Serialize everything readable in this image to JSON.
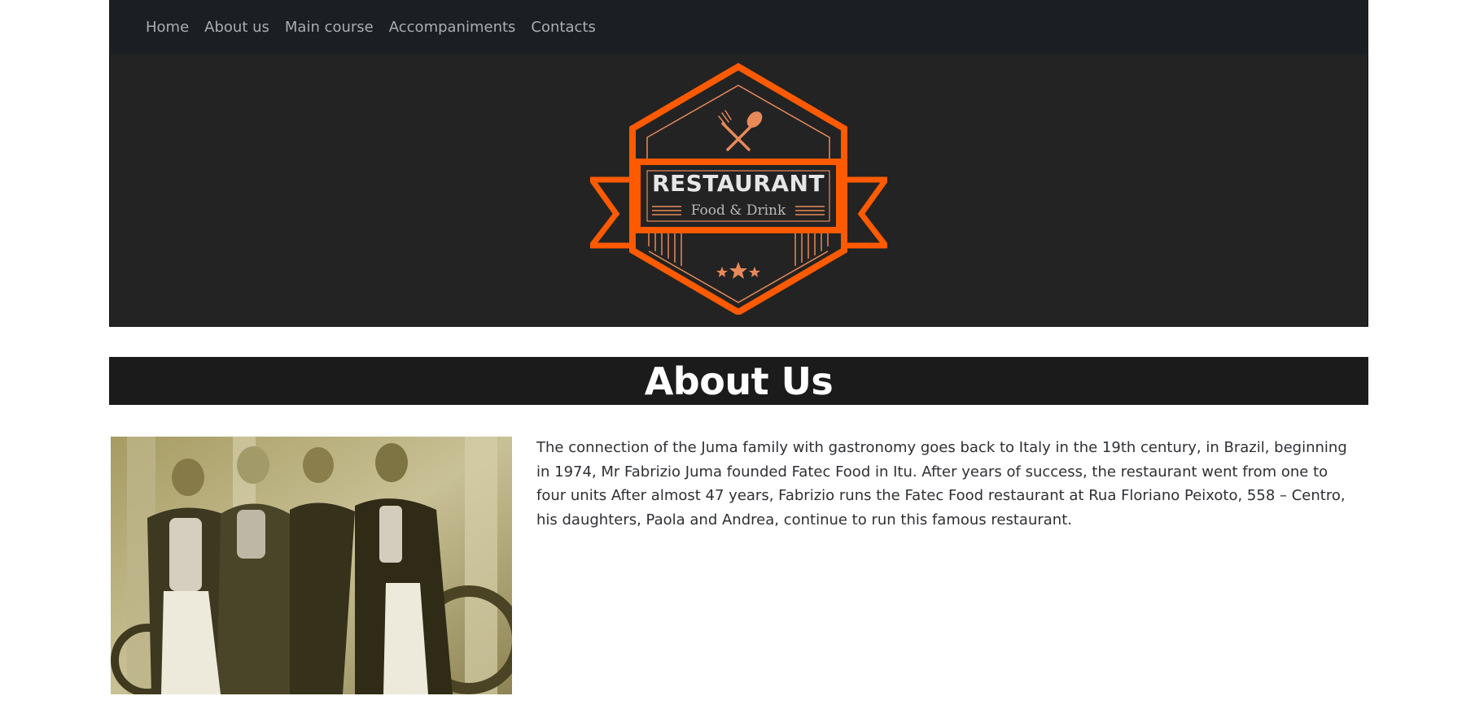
{
  "nav": {
    "items": [
      {
        "label": "Home"
      },
      {
        "label": "About us"
      },
      {
        "label": "Main course"
      },
      {
        "label": "Accompaniments"
      },
      {
        "label": "Contacts"
      }
    ]
  },
  "logo": {
    "title": "RESTAURANT",
    "subtitle": "Food & Drink",
    "accent_color": "#ff5a00",
    "line_color": "#e8895a"
  },
  "about": {
    "heading": "About Us",
    "photo_icon": "vintage-staff-photo",
    "paragraph": "The connection of the Juma family with gastronomy goes back to Italy in the 19th century, in Brazil, beginning in 1974, Mr Fabrizio Juma founded Fatec Food in Itu. After years of success, the restaurant went from one to four units After almost 47 years, Fabrizio runs the Fatec Food restaurant at Rua Floriano Peixoto, 558 – Centro, his daughters, Paola and Andrea, continue to run this famous restaurant."
  }
}
